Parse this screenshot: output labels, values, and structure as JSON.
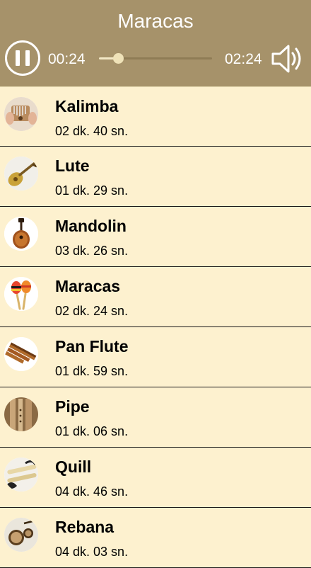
{
  "player": {
    "title": "Maracas",
    "current_time": "00:24",
    "total_time": "02:24",
    "progress": 0.17,
    "state": "playing",
    "pause_icon": "pause-icon",
    "volume_icon": "speaker-volume-icon"
  },
  "colors": {
    "header_bg": "#a6926a",
    "list_bg": "#fdf1cf",
    "text": "#000000",
    "header_text": "#ffffff"
  },
  "songs": [
    {
      "name": "Kalimba",
      "duration": "02 dk. 40 sn.",
      "icon": "kalimba-icon"
    },
    {
      "name": "Lute",
      "duration": "01 dk. 29 sn.",
      "icon": "lute-icon"
    },
    {
      "name": "Mandolin",
      "duration": "03 dk. 26 sn.",
      "icon": "mandolin-icon"
    },
    {
      "name": "Maracas",
      "duration": "02 dk. 24 sn.",
      "icon": "maracas-icon"
    },
    {
      "name": "Pan Flute",
      "duration": "01 dk. 59 sn.",
      "icon": "pan-flute-icon"
    },
    {
      "name": "Pipe",
      "duration": "01 dk. 06 sn.",
      "icon": "pipe-icon"
    },
    {
      "name": "Quill",
      "duration": "04 dk. 46 sn.",
      "icon": "quill-icon"
    },
    {
      "name": "Rebana",
      "duration": "04 dk. 03 sn.",
      "icon": "rebana-icon"
    }
  ]
}
